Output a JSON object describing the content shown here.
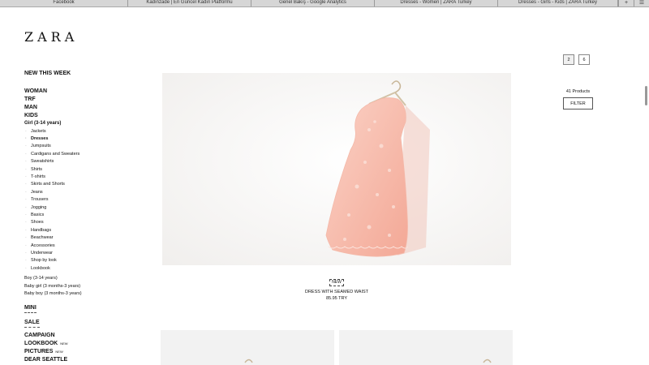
{
  "browser": {
    "tabs": [
      "Facebook",
      "Kadınzade | En Güncel Kadın Platformu",
      "Genel Bakış - Google Analytics",
      "Dresses - Women | ZARA Turkey",
      "Dresses - Girls - Kids | ZARA Turkey"
    ],
    "new_tab_glyph": "+",
    "menu_glyph": "☰"
  },
  "logo": "ZARA",
  "nav": {
    "new_this_week": "NEW THIS WEEK",
    "categories": [
      "WOMAN",
      "TRF",
      "MAN",
      "KIDS"
    ],
    "girl_title": "Girl (3-14 years)",
    "girl_subcategories": [
      "Jackets",
      "Dresses",
      "Jumpsuits",
      "Cardigans and Sweaters",
      "Sweatshirts",
      "Shirts",
      "T-shirts",
      "Skirts and Shorts",
      "Jeans",
      "Trousers",
      "Jogging",
      "Basics",
      "Shoes",
      "Handbags",
      "Beachwear",
      "Accessories",
      "Underwear",
      "Shop by look",
      "Lookbook"
    ],
    "active_subcategory": "Dresses",
    "other_kids": [
      "Boy (3-14 years)",
      "Baby girl (3 months-3 years)",
      "Baby boy (3 months-3 years)"
    ],
    "mini": "MINI",
    "sale": "SALE",
    "bottom": {
      "campaign": "CAMPAIGN",
      "lookbook": "LOOKBOOK",
      "pictures": "PICTURES",
      "dear_seattle": "DEAR SEATTLE",
      "new_tag": "NEW"
    }
  },
  "view_options": [
    "2",
    "6"
  ],
  "products_count": "41 Products",
  "filter_label": "FILTER",
  "product": {
    "badge": "NEW",
    "name": "DRESS WITH SEAMED WAIST",
    "price": "85.95 TRY",
    "color": "#f6b4a4"
  }
}
